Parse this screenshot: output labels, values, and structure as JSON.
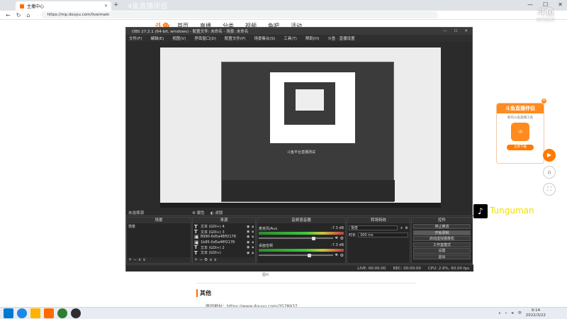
{
  "browser": {
    "tab_title": "主播中心",
    "url": "https://mp.douyu.com/live/main",
    "overlay_title": "4鱼直播伴侣"
  },
  "site": {
    "logo": "斗鱼",
    "nav": [
      "首页",
      "直播",
      "分类",
      "视频",
      "鱼吧",
      "活动"
    ]
  },
  "page": {
    "section_title": "其他",
    "room_link_label": "房间地址：",
    "room_link": "https://www.douyu.com/3578937",
    "small_text": "图片"
  },
  "obs": {
    "title": "OBS 27.2.1 (64-bit, windows) - 配置文件: 未命名 - 场景: 未命名",
    "menu": [
      "文件(F)",
      "编辑(E)",
      "视图(V)",
      "停靠窗口(D)",
      "配置文件(P)",
      "场景集合(S)",
      "工具(T)",
      "帮助(H)",
      "斗鱼 · 直播设置"
    ],
    "preview_caption": "斗鱼平台直播测试",
    "no_source": "未选择源",
    "props_button": "属性",
    "filter_button": "滤镜",
    "docks": {
      "scenes": {
        "title": "场景",
        "items": [
          "场景"
        ]
      },
      "sources": {
        "title": "来源",
        "items": [
          {
            "label": "文本 (GDI+) 4",
            "type": "T"
          },
          {
            "label": "文本 (GDI+) 3",
            "type": "T"
          },
          {
            "label": "B990-6d5a48ff2178",
            "type": "img"
          },
          {
            "label": "1b85-0d5a4fff2178",
            "type": "img"
          },
          {
            "label": "文本 (GDI+) 2",
            "type": "T"
          },
          {
            "label": "文本 (GDI+)",
            "type": "T"
          }
        ]
      },
      "mixer": {
        "title": "音频混音器",
        "channels": [
          {
            "name": "麦克风/Aux",
            "db": "-7.3 dB",
            "level": 0.72
          },
          {
            "name": "桌面音频",
            "db": "-7.3 dB",
            "level": 0.66
          }
        ]
      },
      "transitions": {
        "title": "转场特效",
        "type": "渐变",
        "duration_label": "时长",
        "duration": "300 ms"
      },
      "controls": {
        "title": "控件",
        "buttons": [
          "停止推流",
          "开始录制",
          "启动虚拟摄像机",
          "工作室模式",
          "设置",
          "退出"
        ]
      }
    },
    "status": {
      "live": "LIVE: 00:00:00",
      "rec": "REC: 00:00:00",
      "cpu": "CPU: 2.9%, 60.00 fps"
    }
  },
  "ad": {
    "title": "斗鱼直播伴侣",
    "subtitle": "新的斗鱼直播工具",
    "button": "立即下载"
  },
  "tiktok": {
    "name": "Tunguman"
  },
  "watermark": {
    "logo": "斗鱼",
    "num": "3578937"
  },
  "taskbar": {
    "time": "9:14",
    "date": "2022/3/22",
    "lang": "中"
  },
  "colors": {
    "accent": "#ff6a00",
    "obs_bg": "#2b2b2b"
  }
}
